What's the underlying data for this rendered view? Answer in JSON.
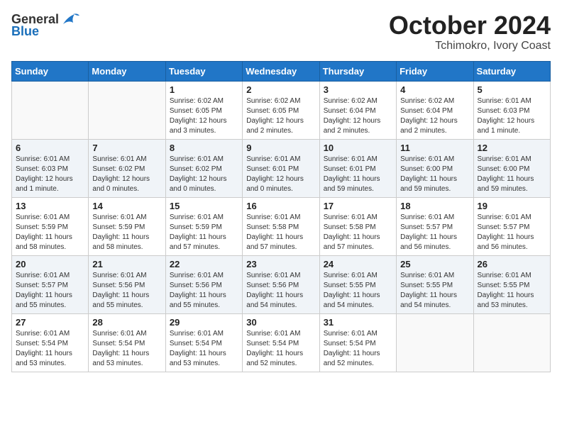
{
  "header": {
    "logo_general": "General",
    "logo_blue": "Blue",
    "month": "October 2024",
    "location": "Tchimokro, Ivory Coast"
  },
  "weekdays": [
    "Sunday",
    "Monday",
    "Tuesday",
    "Wednesday",
    "Thursday",
    "Friday",
    "Saturday"
  ],
  "weeks": [
    [
      {
        "day": "",
        "info": ""
      },
      {
        "day": "",
        "info": ""
      },
      {
        "day": "1",
        "info": "Sunrise: 6:02 AM\nSunset: 6:05 PM\nDaylight: 12 hours and 3 minutes."
      },
      {
        "day": "2",
        "info": "Sunrise: 6:02 AM\nSunset: 6:05 PM\nDaylight: 12 hours and 2 minutes."
      },
      {
        "day": "3",
        "info": "Sunrise: 6:02 AM\nSunset: 6:04 PM\nDaylight: 12 hours and 2 minutes."
      },
      {
        "day": "4",
        "info": "Sunrise: 6:02 AM\nSunset: 6:04 PM\nDaylight: 12 hours and 2 minutes."
      },
      {
        "day": "5",
        "info": "Sunrise: 6:01 AM\nSunset: 6:03 PM\nDaylight: 12 hours and 1 minute."
      }
    ],
    [
      {
        "day": "6",
        "info": "Sunrise: 6:01 AM\nSunset: 6:03 PM\nDaylight: 12 hours and 1 minute."
      },
      {
        "day": "7",
        "info": "Sunrise: 6:01 AM\nSunset: 6:02 PM\nDaylight: 12 hours and 0 minutes."
      },
      {
        "day": "8",
        "info": "Sunrise: 6:01 AM\nSunset: 6:02 PM\nDaylight: 12 hours and 0 minutes."
      },
      {
        "day": "9",
        "info": "Sunrise: 6:01 AM\nSunset: 6:01 PM\nDaylight: 12 hours and 0 minutes."
      },
      {
        "day": "10",
        "info": "Sunrise: 6:01 AM\nSunset: 6:01 PM\nDaylight: 11 hours and 59 minutes."
      },
      {
        "day": "11",
        "info": "Sunrise: 6:01 AM\nSunset: 6:00 PM\nDaylight: 11 hours and 59 minutes."
      },
      {
        "day": "12",
        "info": "Sunrise: 6:01 AM\nSunset: 6:00 PM\nDaylight: 11 hours and 59 minutes."
      }
    ],
    [
      {
        "day": "13",
        "info": "Sunrise: 6:01 AM\nSunset: 5:59 PM\nDaylight: 11 hours and 58 minutes."
      },
      {
        "day": "14",
        "info": "Sunrise: 6:01 AM\nSunset: 5:59 PM\nDaylight: 11 hours and 58 minutes."
      },
      {
        "day": "15",
        "info": "Sunrise: 6:01 AM\nSunset: 5:59 PM\nDaylight: 11 hours and 57 minutes."
      },
      {
        "day": "16",
        "info": "Sunrise: 6:01 AM\nSunset: 5:58 PM\nDaylight: 11 hours and 57 minutes."
      },
      {
        "day": "17",
        "info": "Sunrise: 6:01 AM\nSunset: 5:58 PM\nDaylight: 11 hours and 57 minutes."
      },
      {
        "day": "18",
        "info": "Sunrise: 6:01 AM\nSunset: 5:57 PM\nDaylight: 11 hours and 56 minutes."
      },
      {
        "day": "19",
        "info": "Sunrise: 6:01 AM\nSunset: 5:57 PM\nDaylight: 11 hours and 56 minutes."
      }
    ],
    [
      {
        "day": "20",
        "info": "Sunrise: 6:01 AM\nSunset: 5:57 PM\nDaylight: 11 hours and 55 minutes."
      },
      {
        "day": "21",
        "info": "Sunrise: 6:01 AM\nSunset: 5:56 PM\nDaylight: 11 hours and 55 minutes."
      },
      {
        "day": "22",
        "info": "Sunrise: 6:01 AM\nSunset: 5:56 PM\nDaylight: 11 hours and 55 minutes."
      },
      {
        "day": "23",
        "info": "Sunrise: 6:01 AM\nSunset: 5:56 PM\nDaylight: 11 hours and 54 minutes."
      },
      {
        "day": "24",
        "info": "Sunrise: 6:01 AM\nSunset: 5:55 PM\nDaylight: 11 hours and 54 minutes."
      },
      {
        "day": "25",
        "info": "Sunrise: 6:01 AM\nSunset: 5:55 PM\nDaylight: 11 hours and 54 minutes."
      },
      {
        "day": "26",
        "info": "Sunrise: 6:01 AM\nSunset: 5:55 PM\nDaylight: 11 hours and 53 minutes."
      }
    ],
    [
      {
        "day": "27",
        "info": "Sunrise: 6:01 AM\nSunset: 5:54 PM\nDaylight: 11 hours and 53 minutes."
      },
      {
        "day": "28",
        "info": "Sunrise: 6:01 AM\nSunset: 5:54 PM\nDaylight: 11 hours and 53 minutes."
      },
      {
        "day": "29",
        "info": "Sunrise: 6:01 AM\nSunset: 5:54 PM\nDaylight: 11 hours and 53 minutes."
      },
      {
        "day": "30",
        "info": "Sunrise: 6:01 AM\nSunset: 5:54 PM\nDaylight: 11 hours and 52 minutes."
      },
      {
        "day": "31",
        "info": "Sunrise: 6:01 AM\nSunset: 5:54 PM\nDaylight: 11 hours and 52 minutes."
      },
      {
        "day": "",
        "info": ""
      },
      {
        "day": "",
        "info": ""
      }
    ]
  ]
}
